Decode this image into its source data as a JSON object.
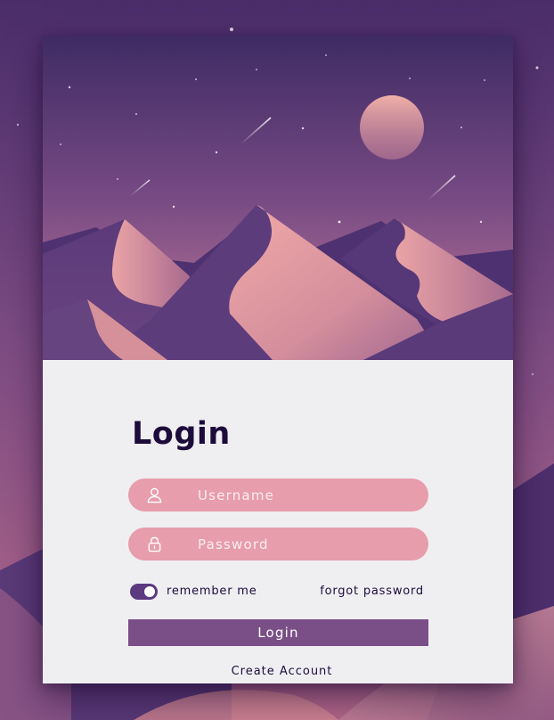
{
  "login_form": {
    "title": "Login",
    "username_placeholder": "Username",
    "password_placeholder": "Password",
    "remember_me_label": "remember me",
    "remember_me_checked": true,
    "forgot_password_label": "forgot password",
    "login_button_label": "Login",
    "create_account_label": "Create Account"
  },
  "icons": {
    "username": "user-icon",
    "password": "lock-icon"
  },
  "colors": {
    "title_text": "#1d0c3b",
    "input_background": "#e79dab",
    "button_background": "#7a4f87",
    "toggle_background": "#5b3a80",
    "form_background": "#efeff2"
  }
}
